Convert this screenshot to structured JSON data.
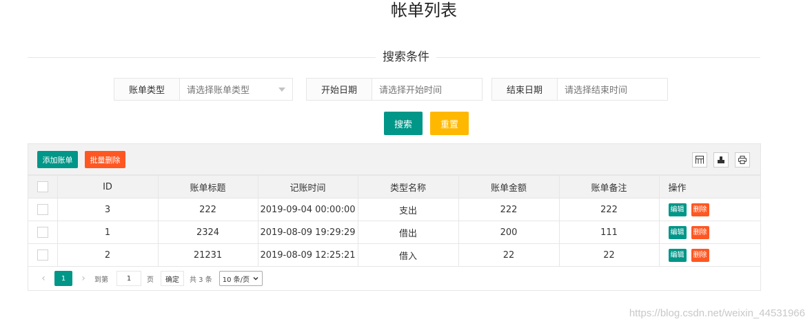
{
  "title": "帐单列表",
  "search": {
    "legend": "搜索条件",
    "type_label": "账单类型",
    "type_placeholder": "请选择账单类型",
    "start_label": "开始日期",
    "start_placeholder": "请选择开始时间",
    "end_label": "结束日期",
    "end_placeholder": "请选择结束时间",
    "search_btn": "搜索",
    "reset_btn": "重置"
  },
  "toolbar": {
    "add_btn": "添加账单",
    "batch_delete_btn": "批量删除",
    "icons": [
      "columns-icon",
      "export-icon",
      "print-icon"
    ]
  },
  "table": {
    "headers": [
      "ID",
      "账单标题",
      "记账时间",
      "类型名称",
      "账单金额",
      "账单备注",
      "操作"
    ],
    "rows": [
      {
        "id": "3",
        "title": "222",
        "time": "2019-09-04 00:00:00",
        "type": "支出",
        "amount": "222",
        "note": "222"
      },
      {
        "id": "1",
        "title": "2324",
        "time": "2019-08-09 19:29:29",
        "type": "借出",
        "amount": "200",
        "note": "111"
      },
      {
        "id": "2",
        "title": "21231",
        "time": "2019-08-09 12:25:21",
        "type": "借入",
        "amount": "22",
        "note": "22"
      }
    ],
    "edit_label": "编辑",
    "delete_label": "删除"
  },
  "pager": {
    "prev": "‹",
    "current": "1",
    "next": "›",
    "goto_label": "到第",
    "goto_value": "1",
    "page_unit": "页",
    "confirm": "确定",
    "total": "共 3 条",
    "page_size": "10 条/页"
  },
  "colors": {
    "primary": "#009688",
    "warm": "#FFB800",
    "danger": "#FF5722"
  },
  "watermark": "https://blog.csdn.net/weixin_44531966"
}
